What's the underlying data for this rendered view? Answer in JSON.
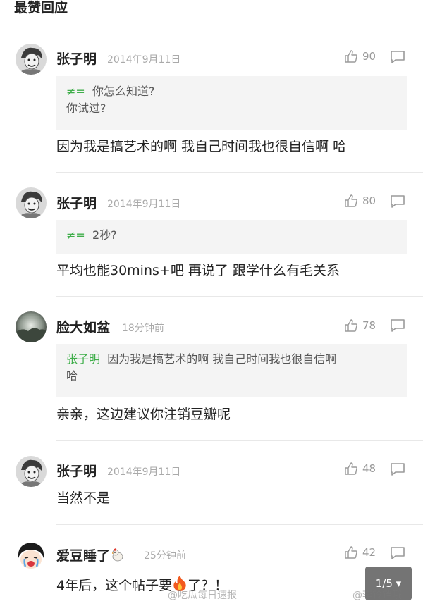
{
  "section_title": "最赞回应",
  "colors": {
    "quote_author": "#3fae4a",
    "meta": "#aaaaaa",
    "quote_bg": "#f4f4f4"
  },
  "comments": [
    {
      "user": "张子明",
      "time": "2014年9月11日",
      "likes": "90",
      "quote_symbol": "≠=",
      "quote_line1": "你怎么知道?",
      "quote_line2": "你试过?",
      "text": "因为我是搞艺术的啊 我自己时间我也很自信啊 哈",
      "avatar_icon": "cartoon-avatar-icon"
    },
    {
      "user": "张子明",
      "time": "2014年9月11日",
      "likes": "80",
      "quote_symbol": "≠=",
      "quote_line1": "2秒?",
      "text": "平均也能30mins+吧 再说了 跟学什么有毛关系",
      "avatar_icon": "cartoon-avatar-icon"
    },
    {
      "user": "脸大如盆",
      "time": "18分钟前",
      "likes": "78",
      "quote_author": "张子明",
      "quote_line1": "因为我是搞艺术的啊 我自己时间我也很自信啊",
      "quote_line2": "哈",
      "text": "亲亲，这边建议你注销豆瓣呢",
      "avatar_icon": "landscape-avatar-icon"
    },
    {
      "user": "张子明",
      "time": "2014年9月11日",
      "likes": "48",
      "text": "当然不是",
      "avatar_icon": "cartoon-avatar-icon"
    },
    {
      "user": "爱豆睡了",
      "time": "25分钟前",
      "likes": "42",
      "text_before": "4年后，这个帖子要",
      "text_after": "了？！",
      "avatar_icon": "crying-girl-avatar-icon"
    }
  ],
  "page_indicator": "1/5 ▾",
  "watermarks": [
    "@吃瓜每日速报",
    "@李铃铛哦"
  ]
}
